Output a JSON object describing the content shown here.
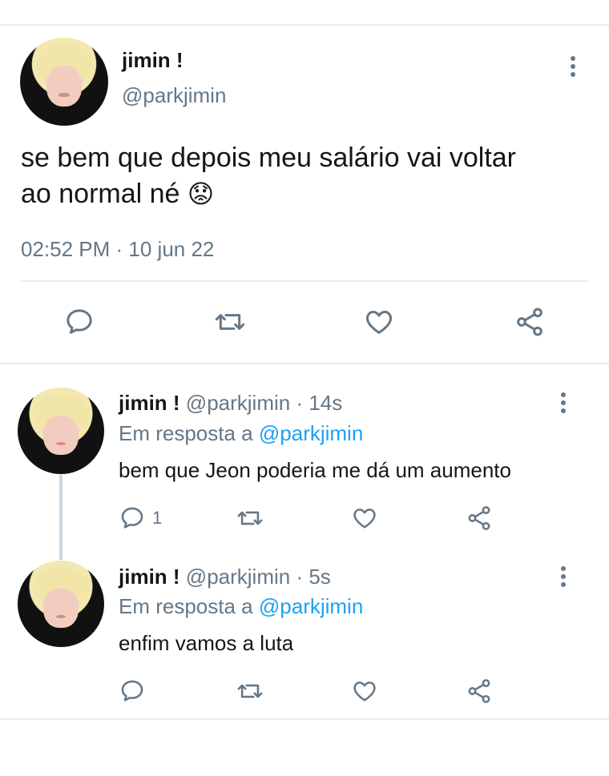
{
  "main_tweet": {
    "name": "jimin !",
    "handle": "@parkjimin",
    "text_line1": "se bem que depois meu salário vai voltar",
    "text_line2": "ao normal né",
    "emoji": "😟",
    "timestamp": "02:52 PM · 10 jun 22"
  },
  "replies": [
    {
      "name": "jimin !",
      "handle": "@parkjimin",
      "time": "· 14s",
      "reply_prefix": "Em resposta a",
      "reply_to": "@parkjimin",
      "text": "bem que Jeon poderia me dá um aumento",
      "reply_count": "1"
    },
    {
      "name": "jimin !",
      "handle": "@parkjimin",
      "time": "· 5s",
      "reply_prefix": "Em resposta a",
      "reply_to": "@parkjimin",
      "text": "enfim vamos a luta",
      "reply_count": ""
    }
  ],
  "colors": {
    "accent": "#1da1f2",
    "secondary_text": "#657786",
    "divider": "#e6ecf0"
  },
  "icons": [
    "more-options-icon",
    "reply-icon",
    "retweet-icon",
    "like-icon",
    "share-icon"
  ]
}
